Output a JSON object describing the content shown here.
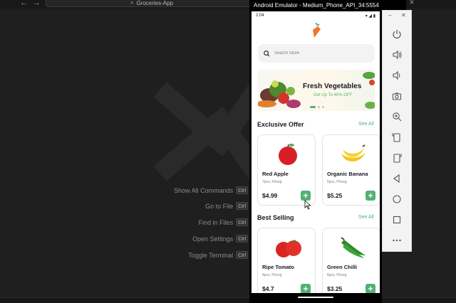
{
  "vscode": {
    "search_text": "Groceries-App",
    "commands": [
      {
        "label": "Show All Commands",
        "key": "Ctrl"
      },
      {
        "label": "Go to File",
        "key": "Ctrl"
      },
      {
        "label": "Find in Files",
        "key": "Ctrl"
      },
      {
        "label": "Open Settings",
        "key": "Ctrl"
      },
      {
        "label": "Toggle Terminal",
        "key": "Ctrl"
      }
    ]
  },
  "emulator": {
    "title": "Android Emulator - Medium_Phone_API_34:5554"
  },
  "app": {
    "status_time": "2:04",
    "search_placeholder": "Search Store",
    "banner": {
      "title": "Fresh Vegetables",
      "subtitle": "Get Up To 40% OFF"
    },
    "exclusive": {
      "title": "Exclusive Offer",
      "see_all": "See All",
      "items": [
        {
          "name": "Red Apple",
          "sub": "7pcs, Priceg",
          "price": "$4.99"
        },
        {
          "name": "Organic Banana",
          "sub": "5pcs, Priceg",
          "price": "$5.25"
        }
      ]
    },
    "best": {
      "title": "Best Selling",
      "see_all": "See All",
      "items": [
        {
          "name": "Ripe Tomato",
          "sub": "4pcs, Priceg",
          "price": "$4.7"
        },
        {
          "name": "Green Chilli",
          "sub": "6pcs, Priceg",
          "price": "$3.25"
        }
      ]
    },
    "colors": {
      "accent": "#53B175",
      "text": "#181725",
      "muted": "#7C7C7C"
    }
  }
}
